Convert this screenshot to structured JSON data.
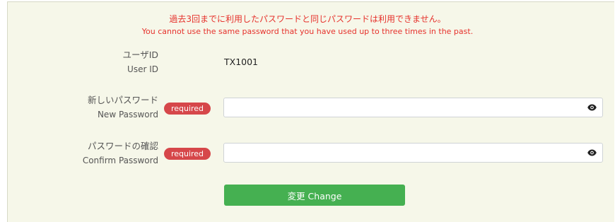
{
  "error": {
    "message_ja": "過去3回までに利用したパスワードと同じパスワードは利用できません。",
    "message_en": "You cannot use the same password that you have used up to three times in the past."
  },
  "user_id": {
    "label_ja": "ユーザID",
    "label_en": "User ID",
    "value": "TX1001"
  },
  "new_password": {
    "label_ja": "新しいパスワード",
    "label_en": "New Password",
    "badge": "required",
    "value": ""
  },
  "confirm_password": {
    "label_ja": "パスワードの確認",
    "label_en": "Confirm Password",
    "badge": "required",
    "value": ""
  },
  "submit": {
    "label": "変更 Change"
  },
  "icons": {
    "toggle_visibility": "eye-icon"
  },
  "colors": {
    "panel_bg": "#f6f7e9",
    "error_text": "#e6322c",
    "required_badge": "#d6474a",
    "button": "#45b051"
  }
}
